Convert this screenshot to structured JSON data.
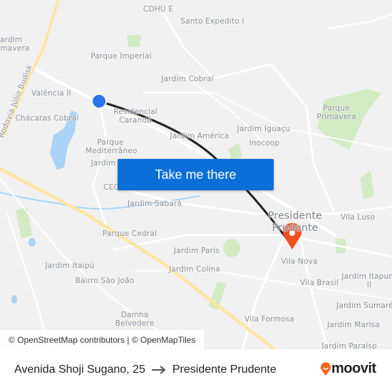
{
  "map": {
    "labels": [
      "CDHU E",
      "Santo Expedito I",
      "Jardim Primavera",
      "Parque Imperial",
      "Jardim Cobral",
      "Valência II",
      "Chácaras Cobral",
      "Residencial Carandá",
      "Jardim América",
      "Jardim Iguaçu",
      "Inocoop",
      "Parque Primavera",
      "Parque Mediterrâneo",
      "Jardim",
      "CEC",
      "Jardim Sabará",
      "Parque Cedral",
      "Jardim Paris",
      "Jardim Colina",
      "Jardim Itaipú",
      "Bairro São João",
      "Damha Belvedere",
      "Vila Luso",
      "Vila Nova",
      "Vila Brasil",
      "Jardim Itapura II",
      "Jardim Sumaré",
      "Jardim Marisa",
      "Jardim Paraíso",
      "Vila Formosa",
      "Rodovia Júlio Budisk",
      "Presidente Prudente"
    ],
    "origin_icon": "origin-dot-icon",
    "destination_icon": "destination-pin-icon",
    "colors": {
      "route": "#222222",
      "origin": "#2a75f0",
      "destination": "#f04e1e",
      "button": "#0b6fd8",
      "highway": "#fbe7a1",
      "park": "#d3ebc4",
      "water": "#aad3f5"
    }
  },
  "cta": {
    "label": "Take me there"
  },
  "attribution": "© OpenStreetMap contributors | © OpenMapTiles",
  "footer": {
    "origin": "Avenida Shoji Sugano, 25",
    "arrow_icon": "arrow-right-icon",
    "destination": "Presidente Prudente"
  },
  "brand": {
    "name": "moovit",
    "icon": "moovit-pin-icon",
    "color": "#f26522"
  }
}
